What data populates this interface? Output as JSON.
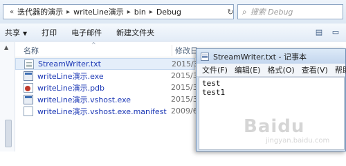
{
  "explorer": {
    "breadcrumbs": [
      "迭代器的演示",
      "writeLine演示",
      "bin",
      "Debug"
    ],
    "search": {
      "placeholder": "搜索 Debug"
    },
    "toolbar": {
      "share_label": "共享",
      "print_label": "打印",
      "email_label": "电子邮件",
      "new_folder_label": "新建文件夹"
    },
    "columns": {
      "name": "名称",
      "date": "修改日"
    },
    "files": [
      {
        "name": "StreamWriter.txt",
        "date": "2015/3",
        "icon": "text-file-icon",
        "selected": true
      },
      {
        "name": "writeLine演示.exe",
        "date": "2015/3",
        "icon": "exe-file-icon",
        "selected": false
      },
      {
        "name": "writeLine演示.pdb",
        "date": "2015/3",
        "icon": "pdb-file-icon",
        "selected": false
      },
      {
        "name": "writeLine演示.vshost.exe",
        "date": "2015/3",
        "icon": "exe-file-icon",
        "selected": false
      },
      {
        "name": "writeLine演示.vshost.exe.manifest",
        "date": "2009/6",
        "icon": "manifest-file-icon",
        "selected": false
      }
    ]
  },
  "notepad": {
    "title": "StreamWriter.txt - 记事本",
    "menu": [
      "文件(F)",
      "编辑(E)",
      "格式(O)",
      "查看(V)",
      "帮助(H)"
    ],
    "content": [
      "test",
      "test1"
    ]
  },
  "watermark": {
    "text": "Baidu",
    "sub": "jingyan.baidu.com"
  },
  "colors": {
    "link": "#1b37b5",
    "selected_row": "#e4eefa",
    "title_bar": "#c3d6ee"
  }
}
